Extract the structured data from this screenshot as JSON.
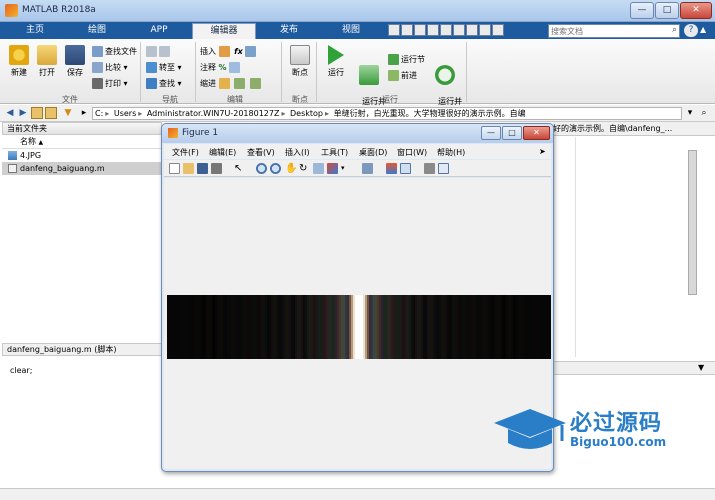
{
  "window": {
    "title": "MATLAB R2018a",
    "min": "—",
    "max": "□",
    "close": "✕"
  },
  "ribbon_tabs": [
    "主页",
    "绘图",
    "APP",
    "编辑器",
    "发布",
    "视图"
  ],
  "active_tab": "编辑器",
  "search": {
    "placeholder": "搜索文档",
    "icon": "search-icon"
  },
  "help_glyph": "?",
  "ribbon": {
    "file": {
      "new": "新建",
      "open": "打开",
      "save": "保存",
      "find_files": "查找文件",
      "compare": "比较",
      "print": "打印",
      "group": "文件"
    },
    "nav": {
      "goto": "转至",
      "find": "查找",
      "group": "导航"
    },
    "edit": {
      "insert": "插入",
      "fx": "fx",
      "comment": "注释",
      "indent": "缩进",
      "group": "编辑"
    },
    "breakpoints": {
      "label": "断点",
      "group": "断点"
    },
    "run": {
      "run": "运行",
      "run_advance": "运行并\n前进",
      "run_section": "运行节",
      "advance": "前进",
      "run_time": "运行并\n计时",
      "group": "运行"
    }
  },
  "address": {
    "crumbs": [
      "C:",
      "Users",
      "Administrator.WIN7U-20180127Z",
      "Desktop",
      "单缝衍射，白光重现。大学物理很好的演示示例。自编"
    ]
  },
  "folder_panel": {
    "title": "当前文件夹",
    "name_col": "名称",
    "sort_glyph": "▲",
    "files": [
      {
        "name": "4.JPG",
        "selected": false
      },
      {
        "name": "danfeng_baiguang.m",
        "selected": true
      }
    ]
  },
  "details": {
    "header": "danfeng_baiguang.m  (脚本)",
    "code": "clear;"
  },
  "right_header": "好的演示示例。自编\\danfeng_...",
  "figure": {
    "title": "Figure 1",
    "menu": [
      "文件(F)",
      "编辑(E)",
      "查看(V)",
      "插入(I)",
      "工具(T)",
      "桌面(D)",
      "窗口(W)",
      "帮助(H)"
    ]
  },
  "colors": {
    "tab_bar": "#1e5a9e",
    "accent_orange": "#e8621c",
    "watermark_blue": "#2a7ec8"
  },
  "watermark": {
    "title": "必过源码",
    "url": "Biguo100.com"
  }
}
